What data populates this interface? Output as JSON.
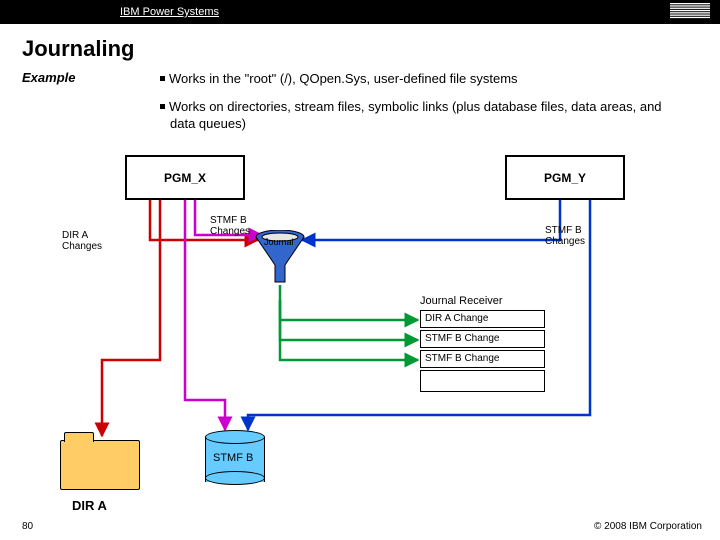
{
  "header": {
    "brand": "IBM Power Systems"
  },
  "title": "Journaling",
  "subtitle": "Example",
  "bullets": [
    "Works in the \"root\" (/), QOpen.Sys, user-defined file systems",
    "Works on directories, stream files, symbolic links (plus database files, data areas, and data queues)"
  ],
  "diagram": {
    "pgm_x": "PGM_X",
    "pgm_y": "PGM_Y",
    "dir_a_changes": "DIR A\nChanges",
    "stmf_b_changes_left": "STMF B\nChanges",
    "stmf_b_changes_right": "STMF B\nChanges",
    "journal": "Journal",
    "journal_receiver": "Journal Receiver",
    "entries": [
      "DIR A Change",
      "STMF B Change",
      "STMF B Change",
      ""
    ],
    "dir_a": "DIR A",
    "stmf_b": "STMF B"
  },
  "footer": {
    "page": "80",
    "copyright": "© 2008 IBM Corporation"
  }
}
